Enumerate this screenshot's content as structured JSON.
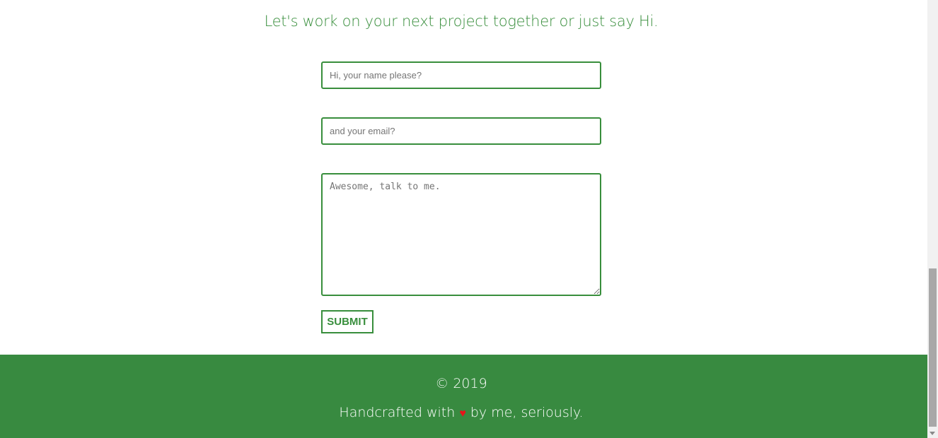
{
  "contact": {
    "heading": "Let's work on your next project together or just say Hi.",
    "name_placeholder": "Hi, your name please?",
    "email_placeholder": "and your email?",
    "message_placeholder": "Awesome, talk to me.",
    "submit_label": "SUBMIT"
  },
  "footer": {
    "copyright": "© 2019",
    "credit_before": "Handcrafted with ",
    "heart": "♥",
    "credit_after": " by me, seriously."
  },
  "colors": {
    "accent": "#388e3c",
    "footer_bg": "#388a40",
    "heart": "#e8131a"
  },
  "icons": [
    "heart-icon",
    "scroll-down-arrow-icon"
  ]
}
